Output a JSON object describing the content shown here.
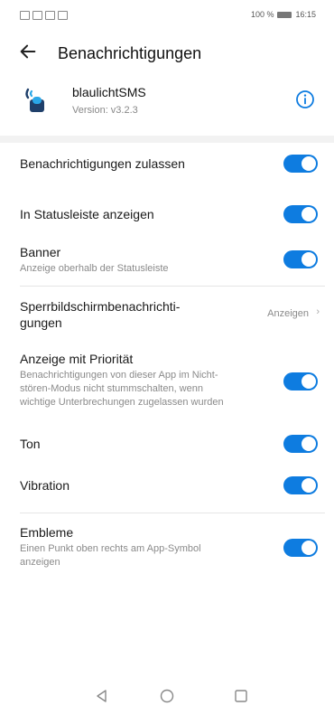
{
  "status_bar": {
    "battery_text": "100 %",
    "time": "16:15"
  },
  "header": {
    "title": "Benachrichtigungen"
  },
  "app": {
    "name": "blaulichtSMS",
    "version": "Version: v3.2.3"
  },
  "settings": {
    "allow": {
      "title": "Benachrichtigungen zulassen",
      "enabled": true
    },
    "statusbar": {
      "title": "In Statusleiste anzeigen",
      "enabled": true
    },
    "banner": {
      "title": "Banner",
      "subtitle": "Anzeige oberhalb der Statusleiste",
      "enabled": true
    },
    "lockscreen": {
      "title_line1": "Sperrbildschirmbenachrichti-",
      "title_line2": "gungen",
      "value": "Anzeigen"
    },
    "priority": {
      "title": "Anzeige mit Priorität",
      "subtitle_line1": "Benachrichtigungen von dieser App im Nicht-",
      "subtitle_line2": "stören-Modus nicht stummschalten, wenn",
      "subtitle_line3": "wichtige Unterbrechungen zugelassen wurden",
      "enabled": true
    },
    "sound": {
      "title": "Ton",
      "enabled": true
    },
    "vibration": {
      "title": "Vibration",
      "enabled": true
    },
    "badges": {
      "title": "Embleme",
      "subtitle_line1": "Einen Punkt oben rechts am App-Symbol",
      "subtitle_line2": "anzeigen",
      "enabled": true
    }
  },
  "colors": {
    "accent": "#0e7ce0",
    "icon_dark": "#1f3f6a",
    "icon_light": "#2aa7e8"
  }
}
